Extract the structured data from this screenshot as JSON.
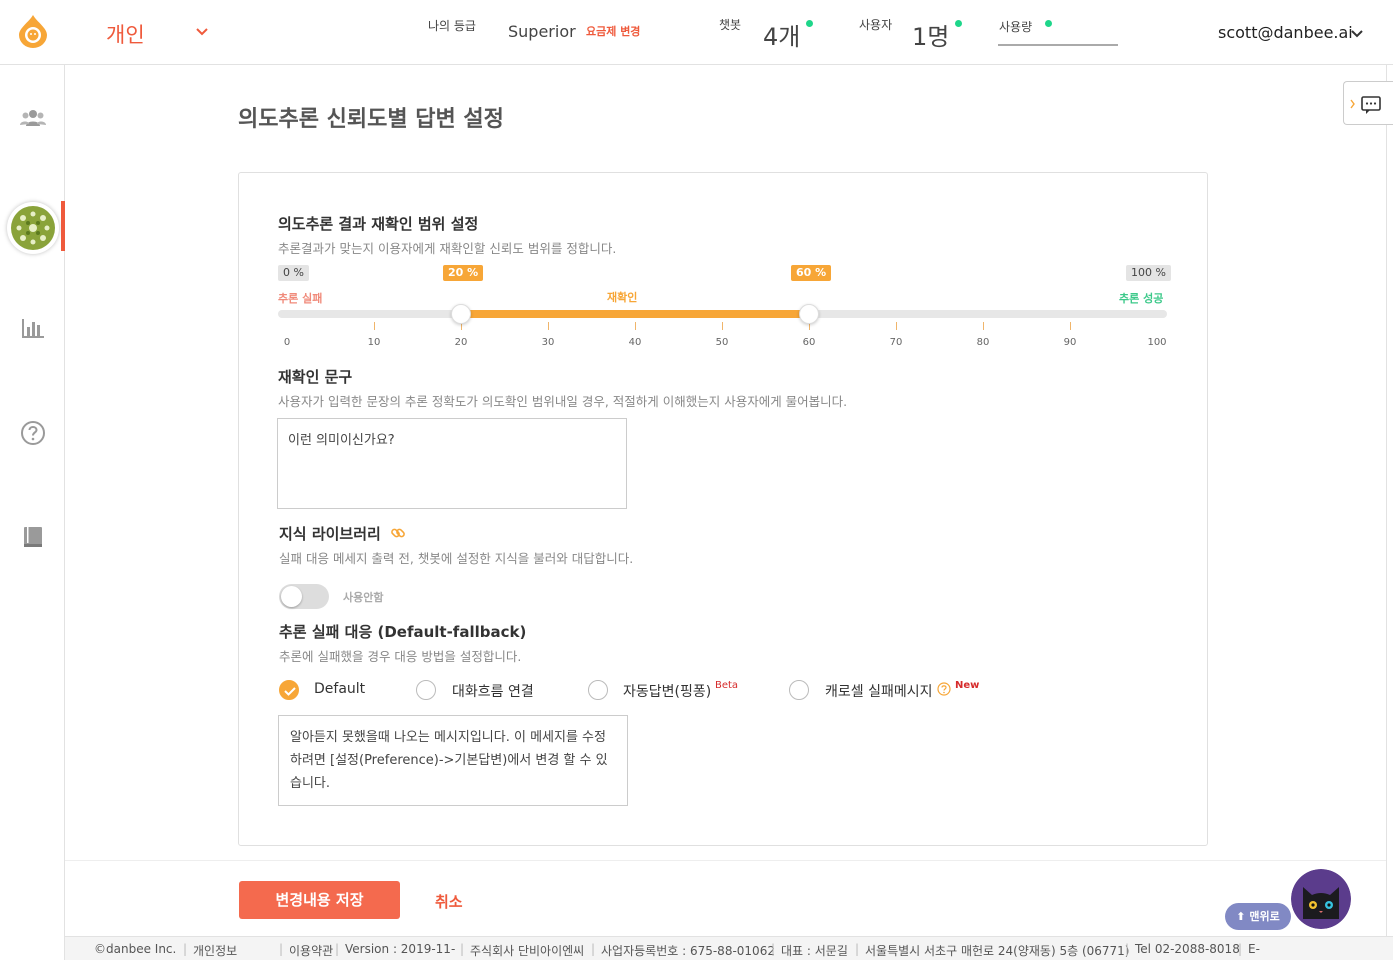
{
  "header": {
    "account_name": "개인",
    "grade_label": "나의 등급",
    "grade_value": "Superior",
    "plan_change": "요금제 변경",
    "chatbot_label": "챗봇",
    "chatbot_count": "4개",
    "users_label": "사용자",
    "users_count": "1명",
    "usage_label": "사용량",
    "user_email": "scott@danbee.ai",
    "status_color": "#1ed68a"
  },
  "sidebar": {
    "items": [
      {
        "icon": "users-icon"
      },
      {
        "icon": "chatbot-avatar"
      },
      {
        "icon": "bar-chart-icon"
      },
      {
        "icon": "help-icon"
      },
      {
        "icon": "book-icon"
      }
    ],
    "active_color": "#ef5a3c"
  },
  "page": {
    "title": "의도추론 신뢰도별 답변 설정"
  },
  "confirm_range": {
    "title": "의도추론 결과 재확인 범위 설정",
    "desc": "추론결과가 맞는지 이용자에게 재확인할 신뢰도 범위를 정합니다.",
    "min_badge": "0 %",
    "max_badge": "100 %",
    "low_badge": "20 %",
    "high_badge": "60 %",
    "low_value": 20,
    "high_value": 60,
    "fail_label": "추론 실패",
    "confirm_label": "재확인",
    "success_label": "추론 성공",
    "fail_color": "#f08a7a",
    "confirm_color": "#f7a637",
    "success_color": "#3cc98a",
    "tick_labels": [
      "0",
      "10",
      "20",
      "30",
      "40",
      "50",
      "60",
      "70",
      "80",
      "90",
      "100"
    ]
  },
  "confirm_phrase": {
    "title": "재확인 문구",
    "desc": "사용자가 입력한 문장의 추론 정확도가 의도확인 범위내일 경우, 적절하게 이해했는지 사용자에게 물어봅니다.",
    "value": "이런 의미이신가요?"
  },
  "knowledge_library": {
    "title": "지식 라이브러리",
    "desc": "실패 대응 메세지 출력 전, 챗봇에 설정한 지식을 불러와 대답합니다.",
    "toggle_label": "사용안함"
  },
  "fallback": {
    "title": "추론 실패 대응 (Default-fallback)",
    "desc": "추론에 실패했을 경우 대응 방법을 설정합니다.",
    "options": [
      {
        "label": "Default",
        "checked": true
      },
      {
        "label": "대화흐름 연결",
        "checked": false
      },
      {
        "label": "자동답변(핑퐁)",
        "checked": false,
        "sup": "Beta"
      },
      {
        "label": "캐로셀 실패메시지",
        "checked": false,
        "sup": "New"
      }
    ],
    "message": "알아듣지 못했을때 나오는 메시지입니다. 이 메세지를 수정하려면 [설정(Preference)->기본답변)에서 변경 할 수 있습니다."
  },
  "actions": {
    "save": "변경내용 저장",
    "cancel": "취소",
    "to_top": "⬆ 맨위로"
  },
  "footer": {
    "items": [
      "©danbee Inc.",
      "개인정보",
      "이용약관",
      "Version : 2019-11-",
      "주식회사 단비아이엔씨",
      "사업자등록번호 : 675-88-01062",
      "대표 : 서문길",
      "서울특별시 서초구 매헌로 24(양재동) 5층 (06771)",
      "Tel 02-2088-8018",
      "E-"
    ]
  }
}
